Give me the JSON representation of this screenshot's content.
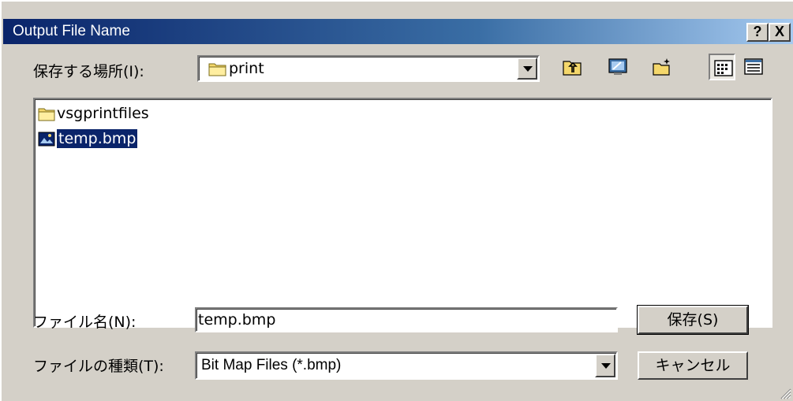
{
  "window": {
    "title": "Output File Name",
    "help_label": "?",
    "close_label": "X"
  },
  "location": {
    "label": "保存する場所(I):",
    "value": "print"
  },
  "toolbar": {
    "icons": [
      "up-folder-icon",
      "desktop-icon",
      "new-folder-icon",
      "list-view-icon",
      "details-view-icon"
    ],
    "pressed": "list-view-icon"
  },
  "file_list": {
    "items": [
      {
        "name": "vsgprintfiles",
        "icon": "folder-icon",
        "selected": false
      },
      {
        "name": "temp.bmp",
        "icon": "bitmap-file-icon",
        "selected": true
      }
    ]
  },
  "filename": {
    "label": "ファイル名(N):",
    "value": "temp.bmp"
  },
  "filetype": {
    "label": "ファイルの種類(T):",
    "value": "Bit Map Files (*.bmp)"
  },
  "buttons": {
    "save_label": "保存(S)",
    "cancel_label": "キャンセル"
  },
  "colors": {
    "title_active": "#0a246a",
    "selection": "#0a246a",
    "face": "#d4d0c8"
  }
}
